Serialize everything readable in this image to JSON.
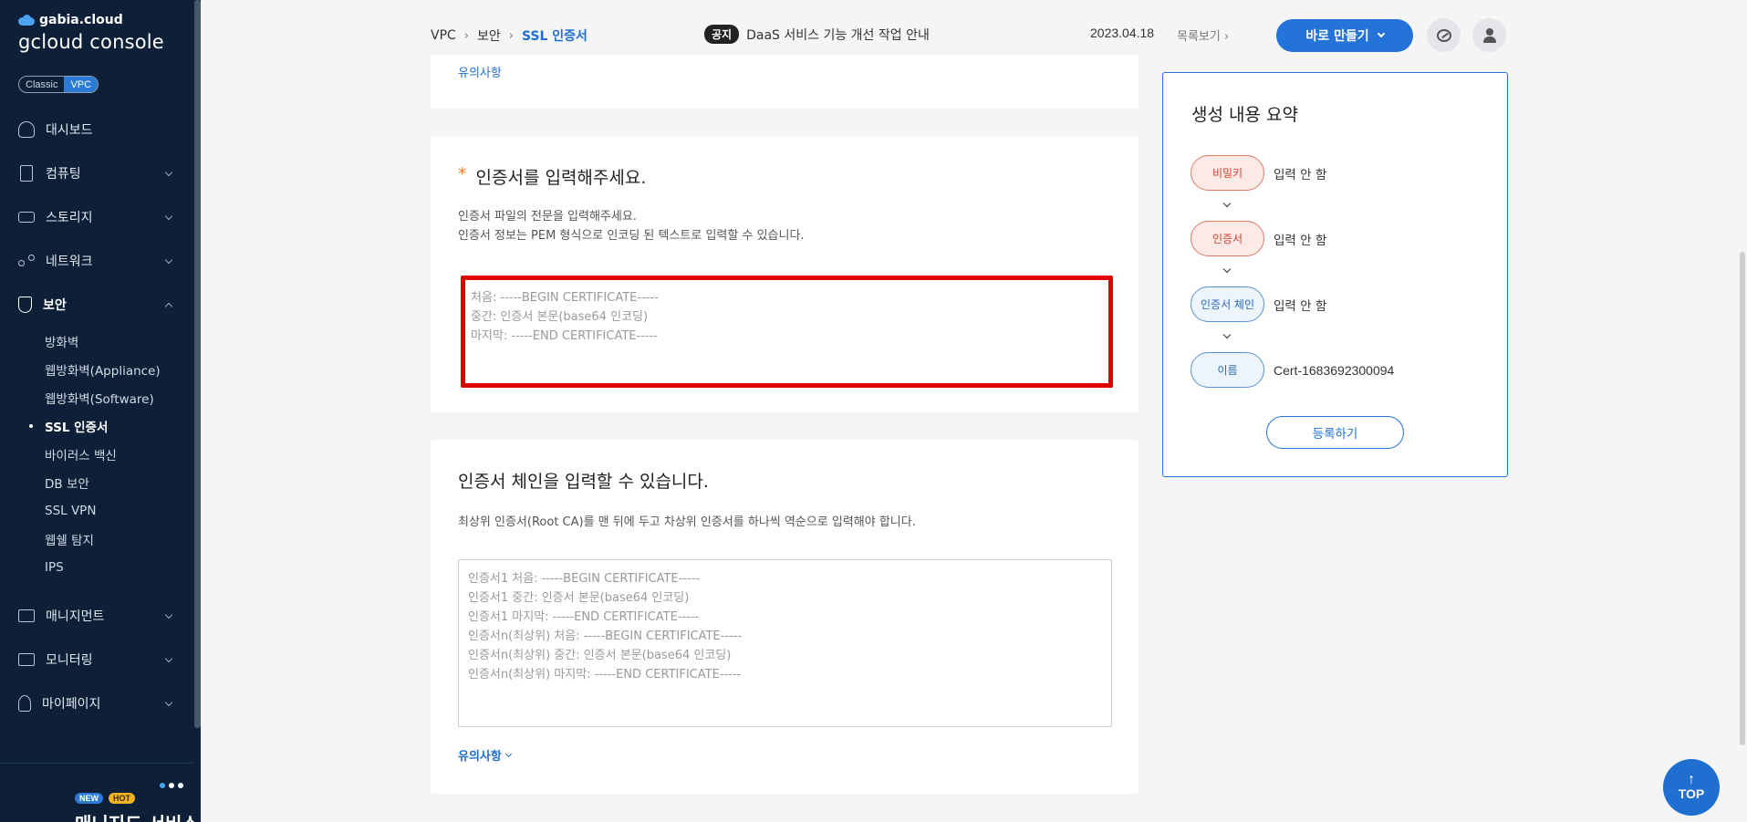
{
  "sidebar": {
    "brand_top": "gabia.cloud",
    "brand_main": "gcloud console",
    "mode_classic": "Classic",
    "mode_vpc": "VPC",
    "items": [
      {
        "label": "대시보드",
        "icon": "dashboard-icon"
      },
      {
        "label": "컴퓨팅",
        "icon": "computing-icon"
      },
      {
        "label": "스토리지",
        "icon": "storage-icon"
      },
      {
        "label": "네트워크",
        "icon": "network-icon"
      },
      {
        "label": "보안",
        "icon": "shield-icon"
      },
      {
        "label": "매니지먼트",
        "icon": "management-icon"
      },
      {
        "label": "모니터링",
        "icon": "monitoring-icon"
      },
      {
        "label": "마이페이지",
        "icon": "user-icon"
      }
    ],
    "security_sub": [
      "방화벽",
      "웹방화벽(Appliance)",
      "웹방화벽(Software)",
      "SSL 인증서",
      "바이러스 백신",
      "DB 보안",
      "SSL VPN",
      "웹쉘 탐지",
      "IPS"
    ],
    "badge_new": "NEW",
    "badge_hot": "HOT",
    "promo": "매니지드 서비스"
  },
  "header": {
    "breadcrumb": [
      "VPC",
      "보안",
      "SSL 인증서"
    ],
    "notice_badge": "공지",
    "notice_text": "DaaS 서비스 기능 개선 작업 안내",
    "notice_date": "2023.04.18",
    "notice_more": "목록보기",
    "create_label": "바로 만들기"
  },
  "top_section": {
    "link": "유의사항"
  },
  "cert_section": {
    "title": "인증서를 입력해주세요.",
    "required_mark": "*",
    "desc_1": "인증서 파일의 전문을 입력해주세요.",
    "desc_2": "인증서 정보는 PEM 형식으로 인코딩 된 텍스트로 입력할 수 있습니다.",
    "placeholder": "처음: -----BEGIN CERTIFICATE-----\n중간: 인증서 본문(base64 인코딩)\n마지막: -----END CERTIFICATE-----"
  },
  "chain_section": {
    "title": "인증서 체인을 입력할 수 있습니다.",
    "desc": "최상위 인증서(Root CA)를 맨 뒤에 두고 차상위 인증서를 하나씩 역순으로 입력해야 합니다.",
    "placeholder": "인증서1 처음: -----BEGIN CERTIFICATE-----\n인증서1 중간: 인증서 본문(base64 인코딩)\n인증서1 마지막: -----END CERTIFICATE-----\n인증서n(최상위) 처음: -----BEGIN CERTIFICATE-----\n인증서n(최상위) 중간: 인증서 본문(base64 인코딩)\n인증서n(최상위) 마지막: -----END CERTIFICATE-----",
    "notes_label": "유의사항"
  },
  "summary": {
    "title": "생성 내용 요약",
    "steps": [
      {
        "label": "비밀키",
        "value": "입력 안 함",
        "status": "empty"
      },
      {
        "label": "인증서",
        "value": "입력 안 함",
        "status": "empty"
      },
      {
        "label": "인증서 체인",
        "value": "입력 안 함",
        "status": "optional"
      },
      {
        "label": "이름",
        "value": "Cert-1683692300094",
        "status": "filled"
      }
    ],
    "register_label": "등록하기"
  },
  "top_button": "TOP",
  "colors": {
    "sidebar_bg": "#0d2037",
    "accent": "#2373d8",
    "error_border": "#e00000",
    "required": "#e8801a"
  }
}
